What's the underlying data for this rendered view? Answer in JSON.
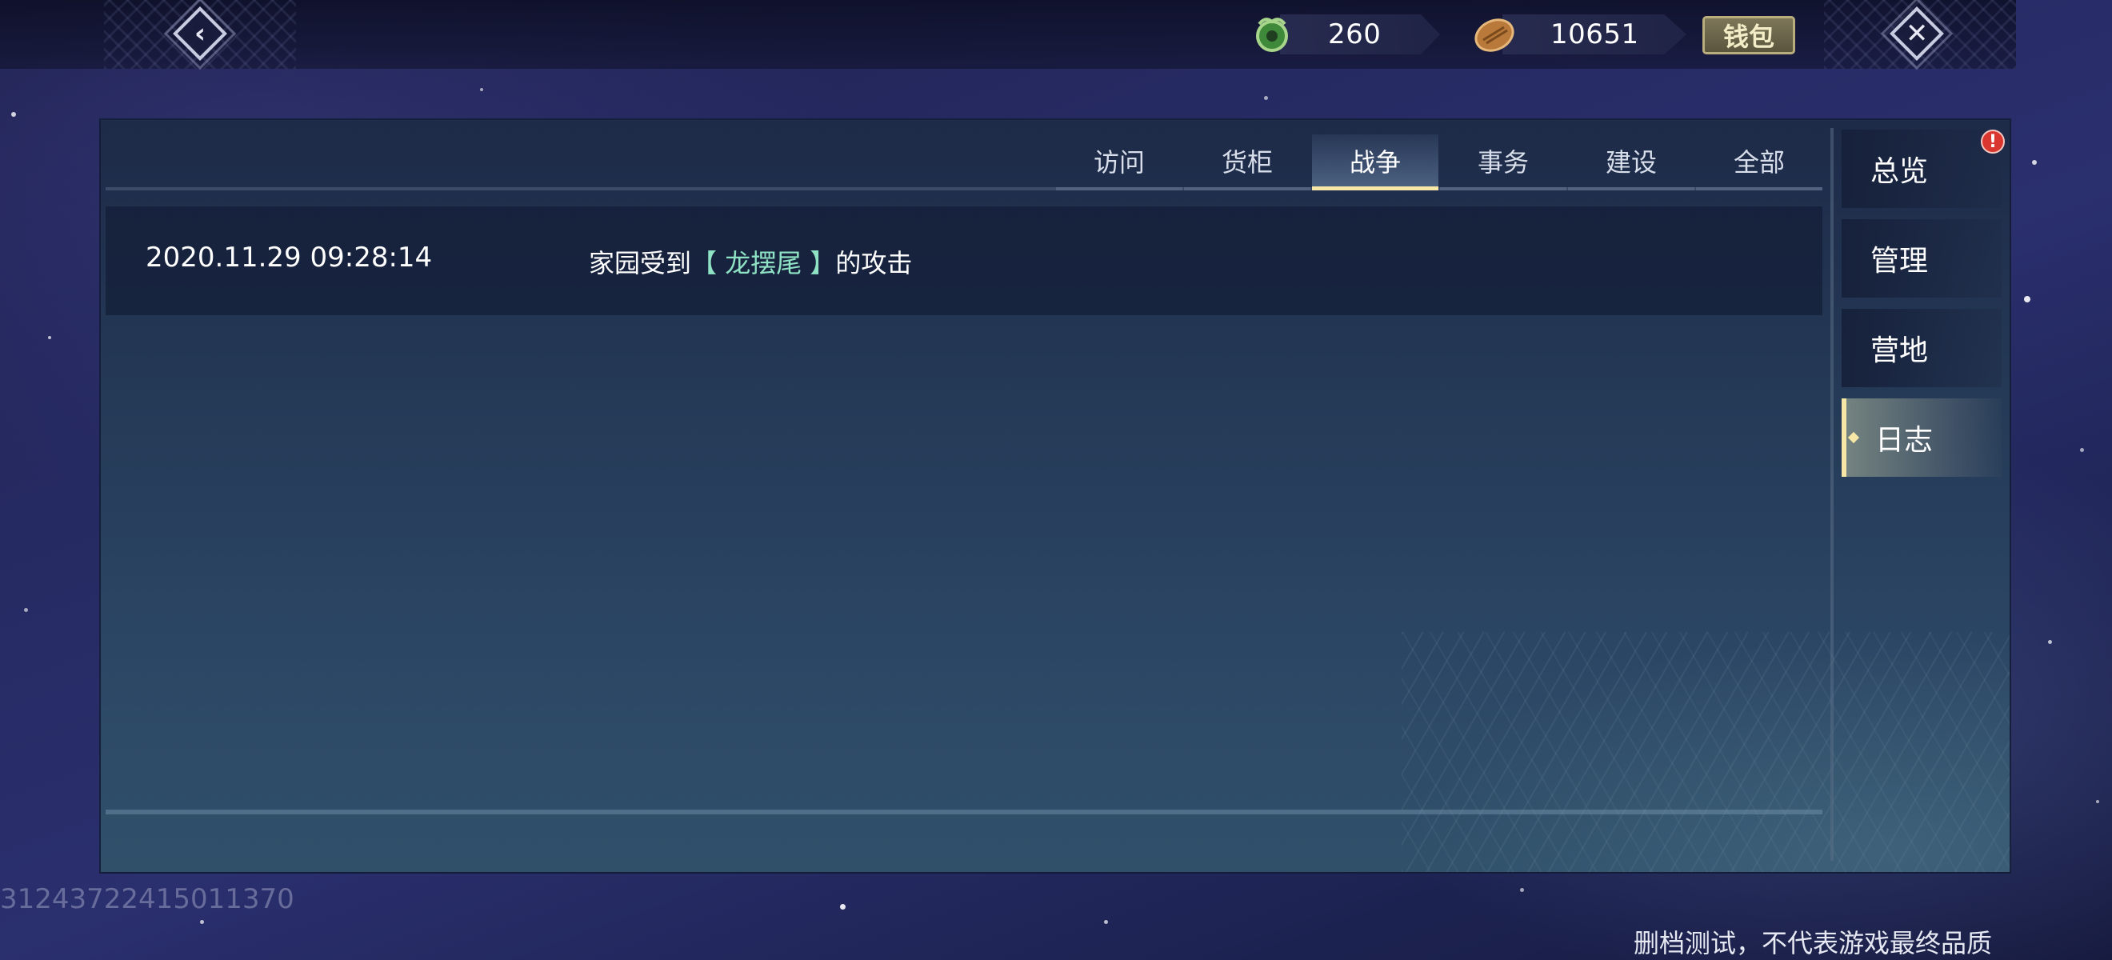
{
  "topbar": {
    "back_icon": "back-arrow-icon",
    "close_icon": "close-x-icon",
    "currencies": [
      {
        "icon": "jade-coin-icon",
        "value": "260"
      },
      {
        "icon": "bread-icon",
        "value": "10651"
      }
    ],
    "wallet_label": "钱包"
  },
  "tabs": [
    {
      "label": "访问",
      "active": false
    },
    {
      "label": "货柜",
      "active": false
    },
    {
      "label": "战争",
      "active": true
    },
    {
      "label": "事务",
      "active": false
    },
    {
      "label": "建设",
      "active": false
    },
    {
      "label": "全部",
      "active": false
    }
  ],
  "log": {
    "entries": [
      {
        "time": "2020.11.29 09:28:14",
        "prefix": "家园受到",
        "target": "【 龙摆尾 】",
        "suffix": "的攻击"
      }
    ]
  },
  "sidebar": {
    "items": [
      {
        "label": "总览",
        "active": false
      },
      {
        "label": "管理",
        "active": false
      },
      {
        "label": "营地",
        "active": false
      },
      {
        "label": "日志",
        "active": true
      }
    ],
    "alert_badge": "!"
  },
  "footer": {
    "id_text": "31243722415011370",
    "disclaimer": "删档测试，不代表游戏最终品质"
  },
  "colors": {
    "accent": "#f6e7a6",
    "highlight_text": "#8fe3c4",
    "alert": "#d8362f"
  }
}
